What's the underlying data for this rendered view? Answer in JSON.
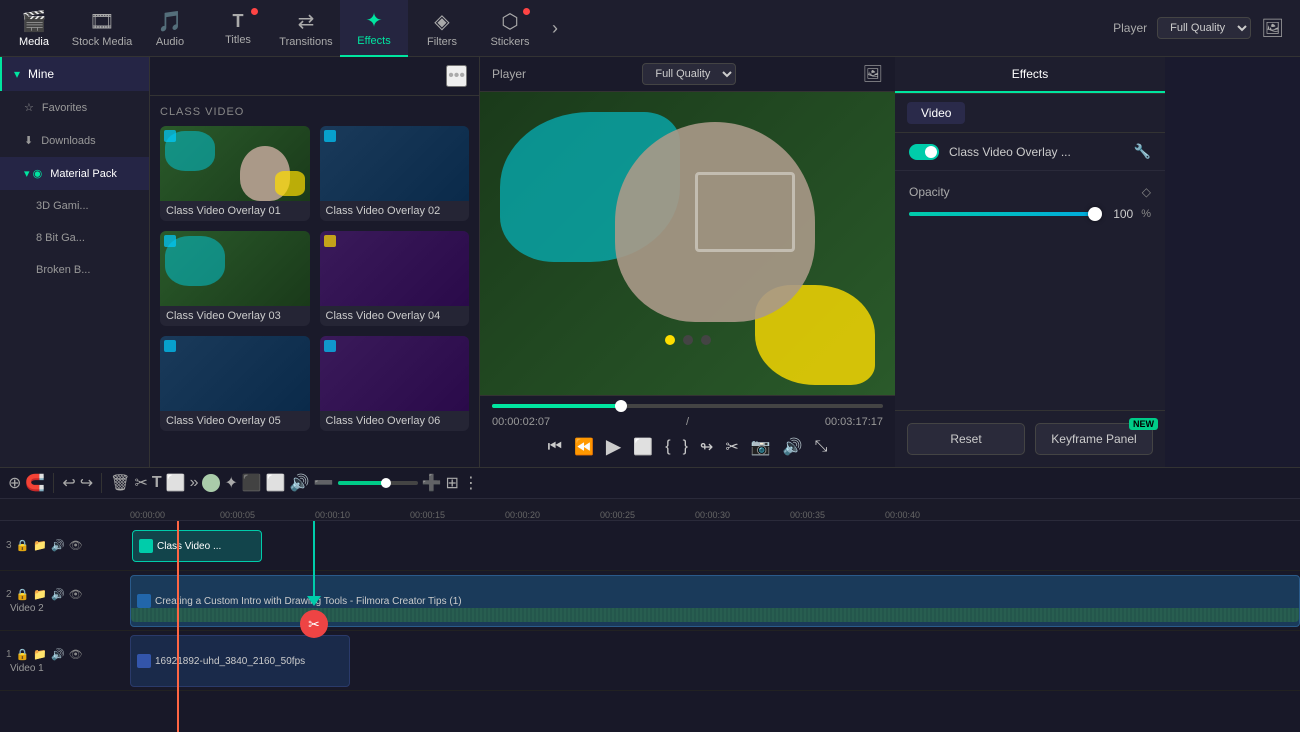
{
  "topbar": {
    "items": [
      {
        "id": "media",
        "label": "Media",
        "icon": "🎬",
        "active": false,
        "dot": false
      },
      {
        "id": "stock-media",
        "label": "Stock Media",
        "icon": "🎞",
        "active": false,
        "dot": false
      },
      {
        "id": "audio",
        "label": "Audio",
        "icon": "🎵",
        "active": false,
        "dot": false
      },
      {
        "id": "titles",
        "label": "Titles",
        "icon": "T",
        "active": false,
        "dot": true
      },
      {
        "id": "transitions",
        "label": "Transitions",
        "icon": "⇄",
        "active": false,
        "dot": false
      },
      {
        "id": "effects",
        "label": "Effects",
        "icon": "✦",
        "active": true,
        "dot": false
      },
      {
        "id": "filters",
        "label": "Filters",
        "icon": "◈",
        "active": false,
        "dot": false
      },
      {
        "id": "stickers",
        "label": "Stickers",
        "icon": "⬡",
        "active": false,
        "dot": true
      }
    ],
    "chevron_label": "›",
    "player_label": "Player",
    "quality_label": "Full Quality"
  },
  "left_panel": {
    "mine_label": "Mine",
    "items": [
      {
        "id": "favorites",
        "label": "Favorites",
        "icon": "☆"
      },
      {
        "id": "downloads",
        "label": "Downloads",
        "icon": "⬇"
      },
      {
        "id": "material-pack",
        "label": "Material Pack",
        "icon": "◉",
        "active": true
      },
      {
        "id": "3d-gaming",
        "label": "3D Gami...",
        "sub": true
      },
      {
        "id": "8bit",
        "label": "8 Bit Ga...",
        "sub": true
      },
      {
        "id": "broken",
        "label": "Broken B...",
        "sub": true
      }
    ]
  },
  "effects_panel": {
    "section_label": "CLASS VIDEO",
    "more_icon": "•••",
    "cards": [
      {
        "id": "cvo1",
        "label": "Class Video Overlay 01"
      },
      {
        "id": "cvo2",
        "label": "Class Video Overlay 02"
      },
      {
        "id": "cvo3",
        "label": "Class Video Overlay 03"
      },
      {
        "id": "cvo4",
        "label": "Class Video Overlay 04"
      },
      {
        "id": "cvo5",
        "label": "Class Video Overlay 05"
      },
      {
        "id": "cvo6",
        "label": "Class Video Overlay 06"
      }
    ]
  },
  "player": {
    "label": "Player",
    "quality": "Full Quality",
    "current_time": "00:00:02:07",
    "total_time": "00:03:17:17"
  },
  "right_panel": {
    "tab_label": "Effects",
    "sub_tab_label": "Video",
    "effect_name": "Class Video Overlay ...",
    "opacity_label": "Opacity",
    "opacity_value": "100",
    "pct": "%",
    "reset_label": "Reset",
    "keyframe_label": "Keyframe Panel",
    "new_badge": "NEW"
  },
  "timeline": {
    "toolbar_buttons": [
      "↩",
      "↪",
      "🗑",
      "✂",
      "T",
      "⬜",
      "»"
    ],
    "tracks": [
      {
        "num": "3",
        "name": "",
        "has_clip": true,
        "clip_label": "Class Video ..."
      },
      {
        "num": "2",
        "name": "Video 2",
        "has_clip": true,
        "clip_label": "Creating a Custom Intro with Drawing Tools - Filmora Creator Tips (1)"
      },
      {
        "num": "1",
        "name": "Video 1",
        "has_clip": true,
        "clip_label": "16921892-uhd_3840_2160_50fps"
      }
    ],
    "time_labels": [
      "00:00:00",
      "00:00:05",
      "00:00:10",
      "00:00:15",
      "00:00:20",
      "00:00:25",
      "00:00:30",
      "00:00:35",
      "00:00:40"
    ]
  }
}
